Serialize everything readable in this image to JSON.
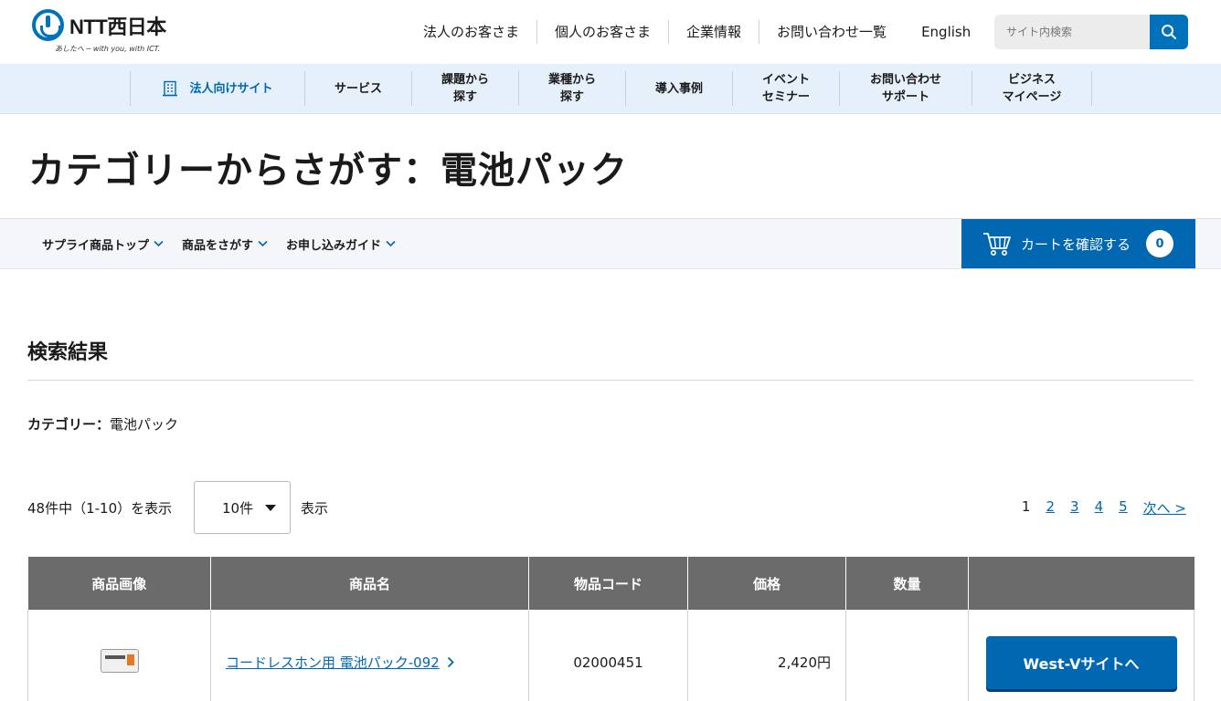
{
  "header": {
    "logo_text": "NTT西日本",
    "logo_tagline": "あしたへ ─ with you, with ICT.",
    "nav": [
      "法人のお客さま",
      "個人のお客さま",
      "企業情報",
      "お問い合わせ一覧",
      "English"
    ],
    "search_placeholder": "サイト内検索"
  },
  "subnav": {
    "items": [
      "法人向けサイト",
      "サービス",
      "課題から\n探す",
      "業種から\n探す",
      "導入事例",
      "イベント\nセミナー",
      "お問い合わせ\nサポート",
      "ビジネス\nマイページ"
    ]
  },
  "page_title": "カテゴリーからさがす：電池パック",
  "supply_menu": [
    "サプライ商品トップ",
    "商品をさがす",
    "お申し込みガイド"
  ],
  "cart": {
    "label": "カートを確認する",
    "count": "0"
  },
  "results": {
    "heading": "検索結果",
    "category_label": "カテゴリー：",
    "category_value": "電池パック",
    "count_text": "48件中（1-10）を表示",
    "per_page": "10件",
    "per_page_suffix": "表示",
    "pages": [
      "1",
      "2",
      "3",
      "4",
      "5",
      "次へ >"
    ]
  },
  "table": {
    "headers": [
      "商品画像",
      "商品名",
      "物品コード",
      "価格",
      "数量",
      ""
    ],
    "rows": [
      {
        "name": "コードレスホン用 電池パック-092",
        "code": "02000451",
        "price": "2,420円",
        "button": "West-Vサイトへ"
      }
    ]
  },
  "colors": {
    "brand_blue": "#0067b0",
    "subnav_bg": "#e6f0fa",
    "table_header": "#6b6b6b"
  }
}
